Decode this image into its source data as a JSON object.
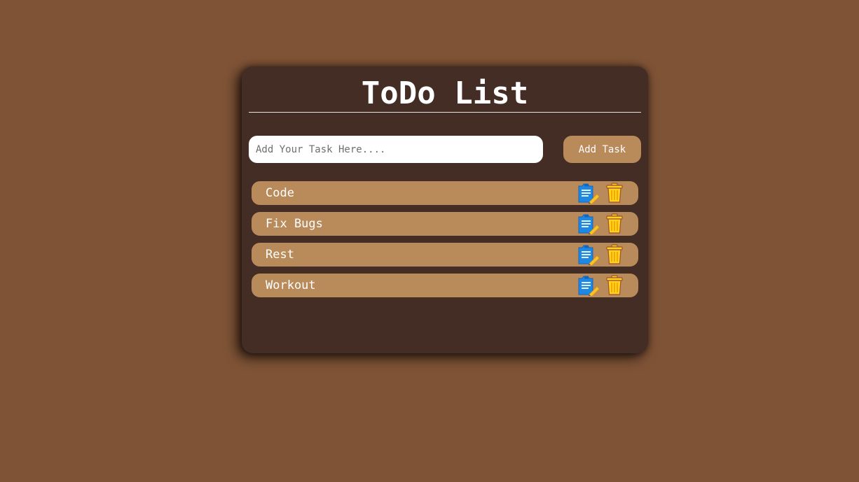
{
  "header": {
    "title": "ToDo List"
  },
  "form": {
    "placeholder": "Add Your Task Here....",
    "value": "",
    "add_label": "Add Task"
  },
  "tasks": [
    {
      "label": "Code"
    },
    {
      "label": "Fix Bugs"
    },
    {
      "label": "Rest"
    },
    {
      "label": "Workout"
    }
  ],
  "icons": {
    "edit": "edit-note-icon",
    "delete": "trash-icon"
  },
  "colors": {
    "page_background": "#7f5336",
    "card_background": "#442d25",
    "accent": "#b98a5a",
    "text": "#ffffff",
    "edit_icon": "#1e88e5",
    "pencil": "#fbc02d",
    "trash": "#ffd21f"
  }
}
